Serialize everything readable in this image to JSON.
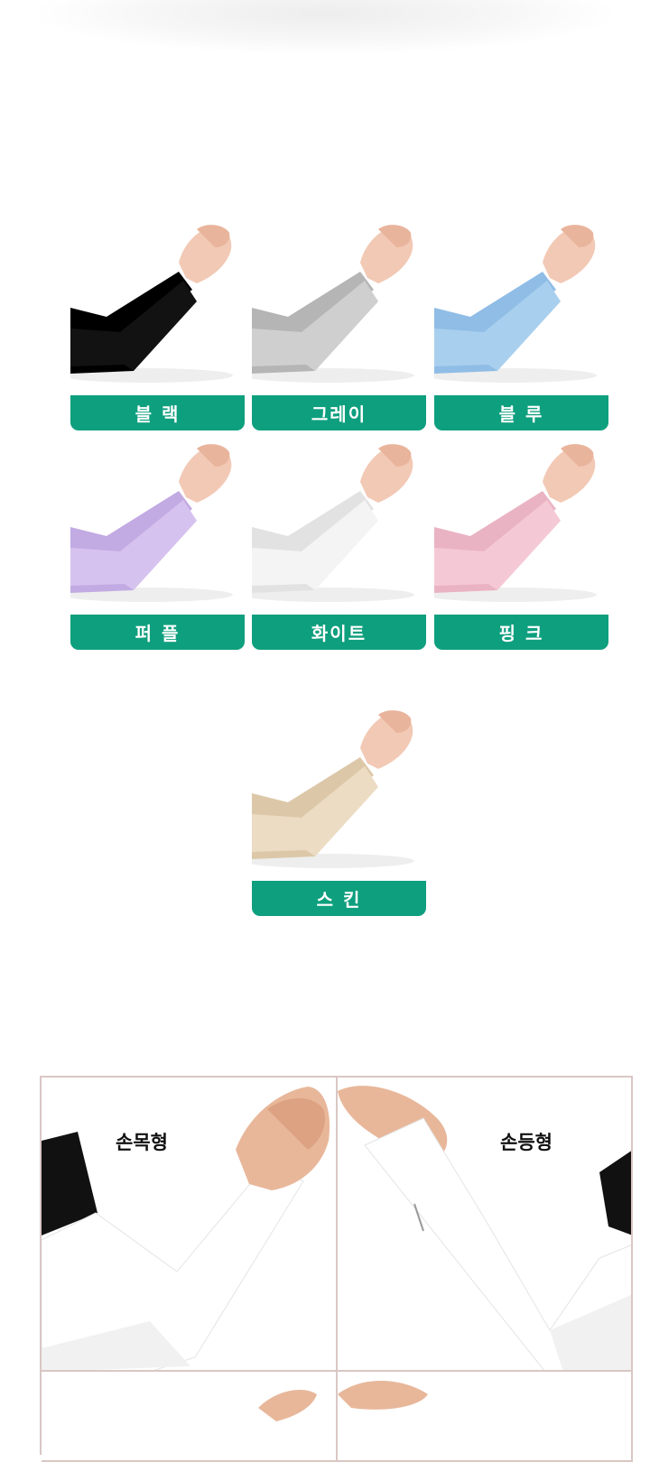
{
  "colors": {
    "label_bg": "#0e9f7e",
    "grid_border": "#d9c7c4"
  },
  "swatches": [
    {
      "name": "블 랙",
      "sleeve": "#121212",
      "sleeve_shade": "#000000"
    },
    {
      "name": "그레이",
      "sleeve": "#cfcfcf",
      "sleeve_shade": "#b5b5b5"
    },
    {
      "name": "블 루",
      "sleeve": "#a9cfee",
      "sleeve_shade": "#8fbde6"
    },
    {
      "name": "퍼 플",
      "sleeve": "#d6c2ee",
      "sleeve_shade": "#c2aae3"
    },
    {
      "name": "화이트",
      "sleeve": "#f4f4f4",
      "sleeve_shade": "#e2e2e2"
    },
    {
      "name": "핑 크",
      "sleeve": "#f4c9d5",
      "sleeve_shade": "#eab3c3"
    },
    {
      "name": "스 킨",
      "sleeve": "#ecdcc3",
      "sleeve_shade": "#dcc8a8"
    }
  ],
  "fit_types": [
    {
      "label": "손목형"
    },
    {
      "label": "손등형"
    }
  ]
}
